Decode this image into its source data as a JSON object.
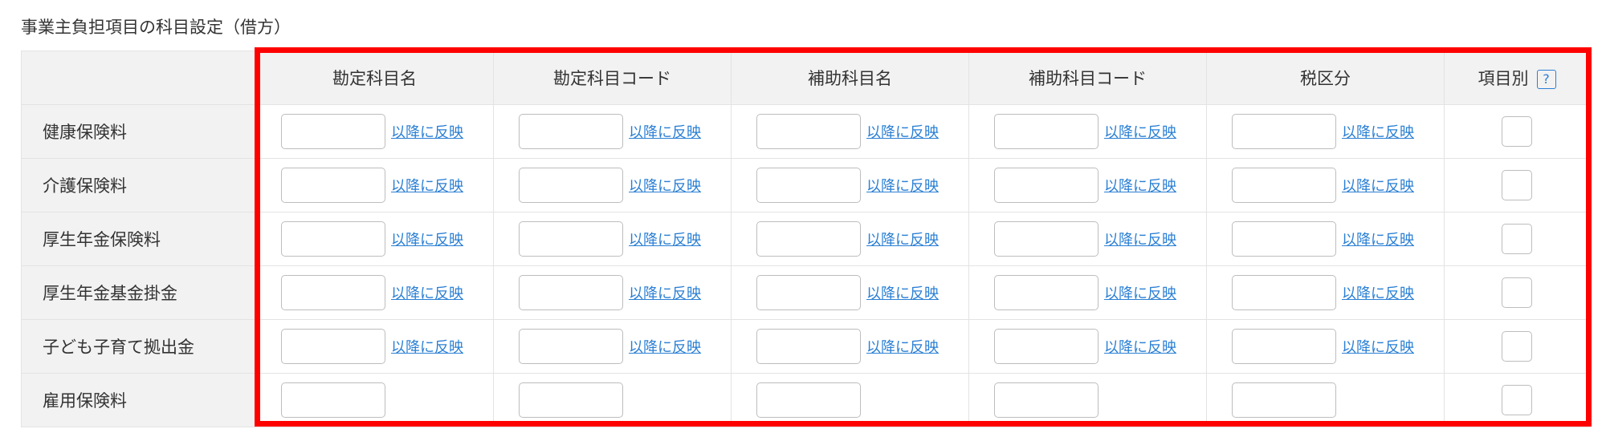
{
  "section_title": "事業主負担項目の科目設定（借方）",
  "columns": {
    "account_name": "勘定科目名",
    "account_code": "勘定科目コード",
    "sub_account_name": "補助科目名",
    "sub_account_code": "補助科目コード",
    "tax_category": "税区分",
    "per_item": "項目別",
    "help": "?"
  },
  "reflect_link": "以降に反映",
  "rows": [
    {
      "label": "健康保険料"
    },
    {
      "label": "介護保険料"
    },
    {
      "label": "厚生年金保険料"
    },
    {
      "label": "厚生年金基金掛金"
    },
    {
      "label": "子ども子育て拠出金"
    },
    {
      "label": "雇用保険料"
    }
  ],
  "colors": {
    "highlight": "#ff0000",
    "link": "#2a7fd4",
    "header_bg": "#f2f2f2"
  }
}
